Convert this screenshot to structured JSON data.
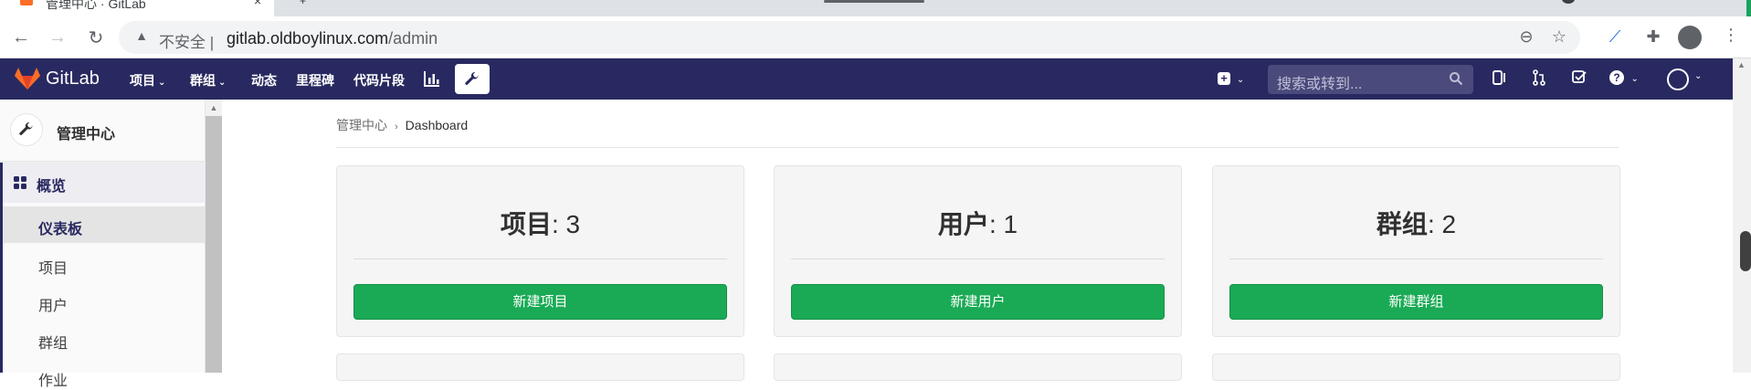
{
  "browser": {
    "tab_title": "管理中心 · GitLab",
    "insecure_label": "不安全",
    "url_host": "gitlab.oldboylinux.com",
    "url_path": "/admin"
  },
  "header": {
    "brand": "GitLab",
    "menus": [
      {
        "label": "项目",
        "caret": true
      },
      {
        "label": "群组",
        "caret": true
      },
      {
        "label": "动态",
        "caret": false
      },
      {
        "label": "里程碑",
        "caret": false
      },
      {
        "label": "代码片段",
        "caret": false
      }
    ],
    "search_placeholder": "搜索或转到..."
  },
  "sidebar": {
    "title": "管理中心",
    "section": "概览",
    "items": [
      "仪表板",
      "项目",
      "用户",
      "群组",
      "作业"
    ],
    "active_index": 0
  },
  "breadcrumb": {
    "parent": "管理中心",
    "current": "Dashboard"
  },
  "cards": [
    {
      "label": "项目",
      "count": ": 3",
      "button": "新建项目"
    },
    {
      "label": "用户",
      "count": ": 1",
      "button": "新建用户"
    },
    {
      "label": "群组",
      "count": ": 2",
      "button": "新建群组"
    }
  ],
  "colors": {
    "header": "#292961",
    "button": "#1aaa55"
  }
}
